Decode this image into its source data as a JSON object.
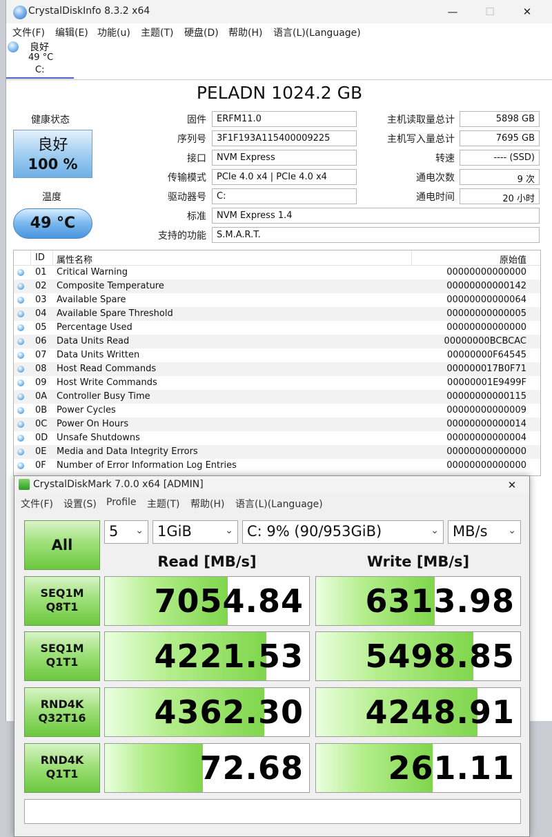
{
  "cdi": {
    "title": "CrystalDiskInfo 8.3.2 x64",
    "window_controls": {
      "minimize": "—",
      "maximize": "☐",
      "close": "✕"
    },
    "menu": [
      "文件(F)",
      "编辑(E)",
      "功能(u)",
      "主题(T)",
      "硬盘(D)",
      "帮助(H)",
      "语言(L)(Language)"
    ],
    "drive_tab": {
      "status": "良好",
      "temp": "49 °C",
      "letter": "C:"
    },
    "drive_title": "PELADN 1024.2 GB",
    "health": {
      "label": "健康状态",
      "status": "良好",
      "percent": "100 %"
    },
    "temperature": {
      "label": "温度",
      "value": "49 °C"
    },
    "info": {
      "firmware": {
        "label": "固件",
        "value": "ERFM11.0"
      },
      "serial": {
        "label": "序列号",
        "value": "3F1F193A115400009225"
      },
      "interface": {
        "label": "接口",
        "value": "NVM Express"
      },
      "transfer_mode": {
        "label": "传输模式",
        "value": "PCIe 4.0 x4 | PCIe 4.0 x4"
      },
      "drive_letter": {
        "label": "驱动器号",
        "value": "C:"
      },
      "standard": {
        "label": "标准",
        "value": "NVM Express 1.4"
      },
      "features": {
        "label": "支持的功能",
        "value": "S.M.A.R.T."
      },
      "host_reads": {
        "label": "主机读取量总计",
        "value": "5898 GB"
      },
      "host_writes": {
        "label": "主机写入量总计",
        "value": "7695 GB"
      },
      "rotation": {
        "label": "转速",
        "value": "---- (SSD)"
      },
      "power_count": {
        "label": "通电次数",
        "value": "9 次"
      },
      "power_hours": {
        "label": "通电时间",
        "value": "20 小时"
      }
    },
    "smart": {
      "headers": {
        "id": "ID",
        "name": "属性名称",
        "raw": "原始值"
      },
      "rows": [
        {
          "id": "01",
          "name": "Critical Warning",
          "raw": "00000000000000"
        },
        {
          "id": "02",
          "name": "Composite Temperature",
          "raw": "00000000000142"
        },
        {
          "id": "03",
          "name": "Available Spare",
          "raw": "00000000000064"
        },
        {
          "id": "04",
          "name": "Available Spare Threshold",
          "raw": "00000000000005"
        },
        {
          "id": "05",
          "name": "Percentage Used",
          "raw": "00000000000000"
        },
        {
          "id": "06",
          "name": "Data Units Read",
          "raw": "00000000BCBCAC"
        },
        {
          "id": "07",
          "name": "Data Units Written",
          "raw": "00000000F64545"
        },
        {
          "id": "08",
          "name": "Host Read Commands",
          "raw": "000000017B0F71"
        },
        {
          "id": "09",
          "name": "Host Write Commands",
          "raw": "00000001E9499F"
        },
        {
          "id": "0A",
          "name": "Controller Busy Time",
          "raw": "00000000000115"
        },
        {
          "id": "0B",
          "name": "Power Cycles",
          "raw": "00000000000009"
        },
        {
          "id": "0C",
          "name": "Power On Hours",
          "raw": "00000000000014"
        },
        {
          "id": "0D",
          "name": "Unsafe Shutdowns",
          "raw": "00000000000004"
        },
        {
          "id": "0E",
          "name": "Media and Data Integrity Errors",
          "raw": "00000000000000"
        },
        {
          "id": "0F",
          "name": "Number of Error Information Log Entries",
          "raw": "00000000000000"
        }
      ]
    }
  },
  "cdm": {
    "title": "CrystalDiskMark 7.0.0 x64 [ADMIN]",
    "close": "✕",
    "menu": [
      "文件(F)",
      "设置(S)",
      "Profile",
      "主题(T)",
      "帮助(H)",
      "语言(L)(Language)"
    ],
    "all_label": "All",
    "count": "5",
    "size": "1GiB",
    "drive": "C: 9% (90/953GiB)",
    "unit": "MB/s",
    "read_header": "Read [MB/s]",
    "write_header": "Write [MB/s]",
    "tests": [
      {
        "line1": "SEQ1M",
        "line2": "Q8T1",
        "read": "7054.84",
        "write": "6313.98",
        "read_fill": 0.6,
        "write_fill": 0.58
      },
      {
        "line1": "SEQ1M",
        "line2": "Q1T1",
        "read": "4221.53",
        "write": "5498.85",
        "read_fill": 0.79,
        "write_fill": 0.77
      },
      {
        "line1": "RND4K",
        "line2": "Q32T16",
        "read": "4362.30",
        "write": "4248.91",
        "read_fill": 0.78,
        "write_fill": 0.79
      },
      {
        "line1": "RND4K",
        "line2": "Q1T1",
        "read": "72.68",
        "write": "261.11",
        "read_fill": 0.48,
        "write_fill": 0.57
      }
    ]
  }
}
